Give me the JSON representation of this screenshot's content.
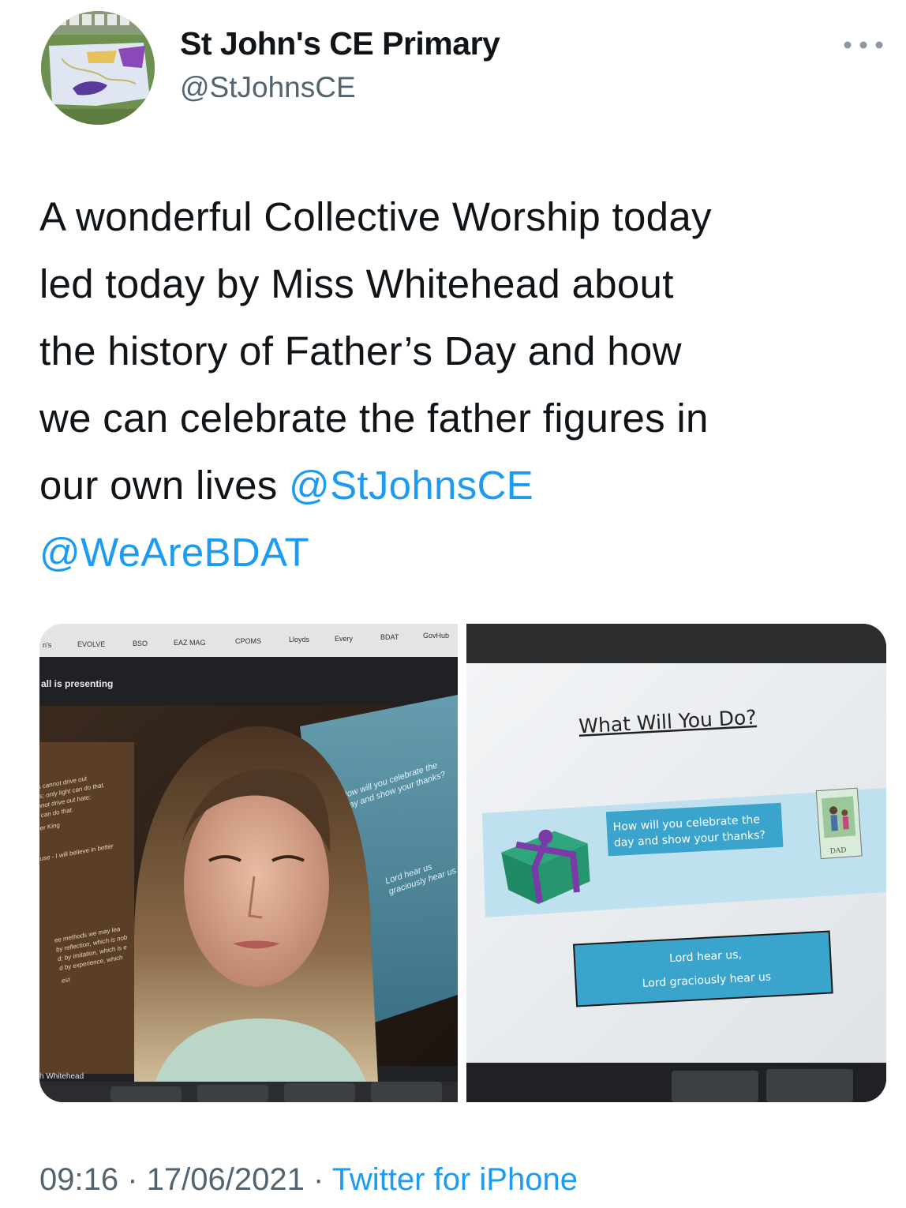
{
  "author": {
    "display_name": "St John's CE Primary",
    "handle": "@StJohnsCE",
    "avatar_icon": "school-artwork-avatar"
  },
  "tweet": {
    "lines": [
      "A wonderful Collective Worship today",
      "led today by Miss Whitehead about",
      "the history of Father’s Day and how",
      "we can celebrate the father figures in"
    ],
    "last_line_text": "our own lives ",
    "mention_1": "@StJohnsCE",
    "mention_2": "@WeAreBDAT"
  },
  "photo_left": {
    "bookmarks": [
      "n's",
      "EVOLVE",
      "BSO",
      "EAZ MAG",
      "CPOMS",
      "Lloyds",
      "Every",
      "BDAT",
      "GovHub"
    ],
    "presenting_label": "all is presenting",
    "name_tag": "h Whitehead",
    "wall_text": [
      "How will you celebrate the",
      "day and show your thanks?",
      "Lord hear us",
      "graciously hear us"
    ],
    "poster_text": [
      "ness cannot drive out",
      "ness; only light can do that.",
      "cannot drive out hate;",
      "ve can do that.",
      "ther King",
      "use - I will believe in better",
      "ee methods we may lea",
      "by reflection, which is nob",
      "d; by imitation, which is e",
      "d by experience, which",
      "est"
    ]
  },
  "photo_right": {
    "slide_title": "What Will You Do?",
    "prompt_line_1": "How will you celebrate the",
    "prompt_line_2": "day and show your thanks?",
    "card_label": "DAD",
    "response_line_1": "Lord hear us,",
    "response_line_2": "Lord graciously hear us"
  },
  "meta": {
    "time": "09:16",
    "separator": " · ",
    "date": "17/06/2021",
    "source": "Twitter for iPhone"
  },
  "colors": {
    "link": "#1d9bf0",
    "secondary_text": "#536471",
    "slide_box": "#3ba4cc"
  }
}
